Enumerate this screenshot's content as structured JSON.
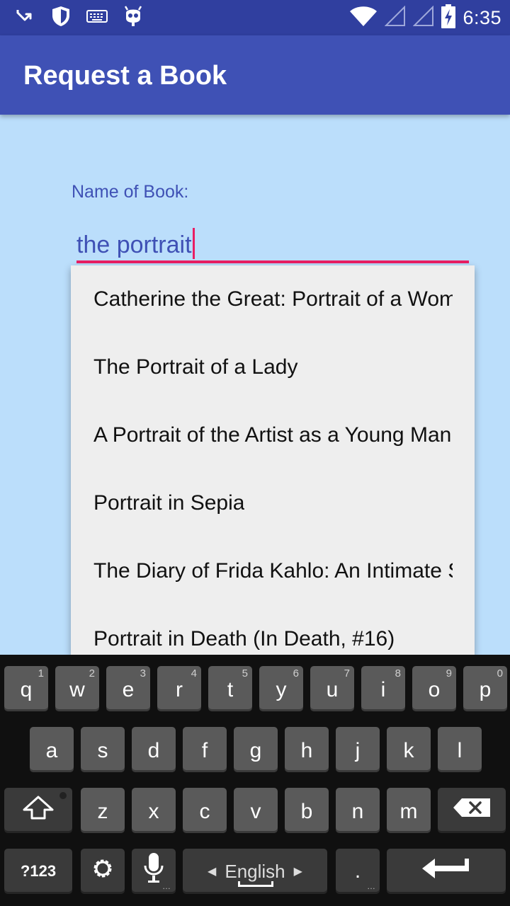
{
  "status_bar": {
    "time": "6:35",
    "left_icons": [
      "missed-call-icon",
      "shield-icon",
      "keyboard-icon",
      "android-debug-icon"
    ],
    "right_icons": [
      "wifi-icon",
      "signal-icon",
      "signal-icon",
      "battery-charging-icon"
    ]
  },
  "app_bar": {
    "title": "Request a Book"
  },
  "form": {
    "label": "Name of Book:",
    "value": "the portrait"
  },
  "suggestions": [
    "Catherine the Great: Portrait of a Woman",
    "The Portrait of a Lady",
    "A Portrait of the Artist as a Young Man",
    "Portrait in Sepia",
    "The Diary of Frida Kahlo: An Intimate Self-Portrait",
    "Portrait in Death (In Death, #16)"
  ],
  "keyboard": {
    "row1": [
      {
        "key": "q",
        "hint": "1"
      },
      {
        "key": "w",
        "hint": "2"
      },
      {
        "key": "e",
        "hint": "3"
      },
      {
        "key": "r",
        "hint": "4"
      },
      {
        "key": "t",
        "hint": "5"
      },
      {
        "key": "y",
        "hint": "6"
      },
      {
        "key": "u",
        "hint": "7"
      },
      {
        "key": "i",
        "hint": "8"
      },
      {
        "key": "o",
        "hint": "9"
      },
      {
        "key": "p",
        "hint": "0"
      }
    ],
    "row2": [
      "a",
      "s",
      "d",
      "f",
      "g",
      "h",
      "j",
      "k",
      "l"
    ],
    "row3": [
      "z",
      "x",
      "c",
      "v",
      "b",
      "n",
      "m"
    ],
    "symbols_label": "?123",
    "language_label": "English",
    "period_label": "."
  }
}
